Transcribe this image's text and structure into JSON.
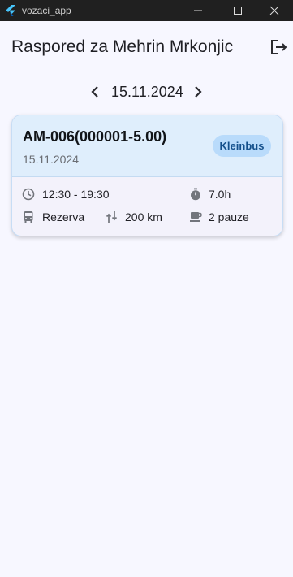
{
  "window": {
    "title": "vozaci_app"
  },
  "header": {
    "title": "Raspored za Mehrin Mrkonjic"
  },
  "date_nav": {
    "date": "15.11.2024"
  },
  "card": {
    "route_code": "AM-006(000001-5.00)",
    "date": "15.11.2024",
    "vehicle_type": "Kleinbus",
    "time_range": "12:30 - 19:30",
    "duration": "7.0h",
    "role": "Rezerva",
    "distance": "200 km",
    "breaks": "2 pauze"
  },
  "colors": {
    "background": "#f7f7ff",
    "card_header": "#dfeefc",
    "badge_bg": "#b9dbfb",
    "badge_text": "#14508c",
    "titlebar": "#202020"
  },
  "icons": {
    "app_logo": "flutter-logo-icon",
    "logout": "logout-icon",
    "prev": "chevron-left-icon",
    "next": "chevron-right-icon",
    "time": "clock-icon",
    "duration": "timer-icon",
    "role": "bus-icon",
    "distance": "route-icon",
    "breaks": "coffee-icon"
  }
}
